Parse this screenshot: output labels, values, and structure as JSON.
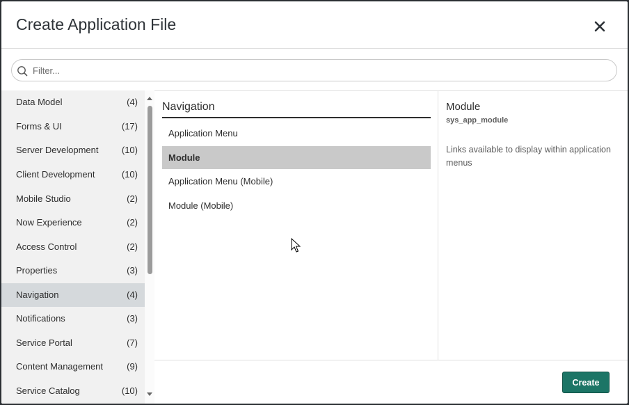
{
  "dialog": {
    "title": "Create Application File"
  },
  "filter": {
    "placeholder": "Filter..."
  },
  "categories": [
    {
      "label": "Data Model",
      "count": "(4)"
    },
    {
      "label": "Forms & UI",
      "count": "(17)"
    },
    {
      "label": "Server Development",
      "count": "(10)"
    },
    {
      "label": "Client Development",
      "count": "(10)"
    },
    {
      "label": "Mobile Studio",
      "count": "(2)"
    },
    {
      "label": "Now Experience",
      "count": "(2)"
    },
    {
      "label": "Access Control",
      "count": "(2)"
    },
    {
      "label": "Properties",
      "count": "(3)"
    },
    {
      "label": "Navigation",
      "count": "(4)"
    },
    {
      "label": "Notifications",
      "count": "(3)"
    },
    {
      "label": "Service Portal",
      "count": "(7)"
    },
    {
      "label": "Content Management",
      "count": "(9)"
    },
    {
      "label": "Service Catalog",
      "count": "(10)"
    }
  ],
  "selected_category": "Navigation",
  "file_types": {
    "heading": "Navigation",
    "items": [
      {
        "label": "Application Menu"
      },
      {
        "label": "Module"
      },
      {
        "label": "Application Menu (Mobile)"
      },
      {
        "label": "Module (Mobile)"
      }
    ],
    "selected": "Module"
  },
  "detail": {
    "name": "Module",
    "table": "sys_app_module",
    "description": "Links available to display within application menus"
  },
  "footer": {
    "create_label": "Create"
  },
  "icons": {
    "close": "close-icon",
    "search": "search-icon",
    "scroll_up": "chevron-up-icon",
    "scroll_down": "chevron-down-icon",
    "cursor": "mouse-pointer-icon"
  },
  "colors": {
    "primary_button": "#1c7566",
    "selected_category_bg": "#d5d9dc",
    "selected_item_bg": "#c9c9c9",
    "sidebar_bg": "#f1f1f1"
  }
}
